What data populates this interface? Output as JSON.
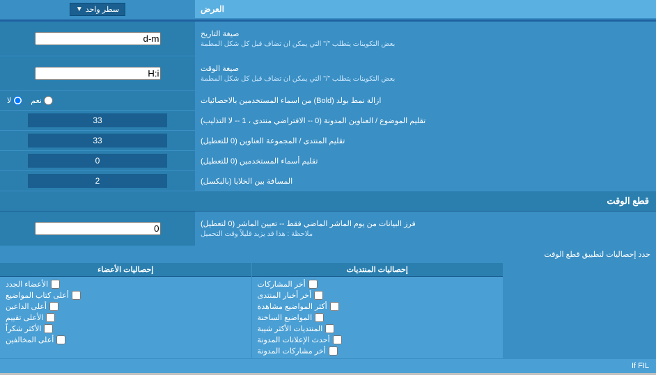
{
  "header": {
    "label_right": "العرض",
    "dropdown_label": "سطر واحد"
  },
  "date_format": {
    "label": "صيغة التاريخ",
    "sublabel": "بعض التكوينات يتطلب \"/\" التي يمكن ان تضاف قبل كل شكل المطمة",
    "value": "d-m"
  },
  "time_format": {
    "label": "صيغة الوقت",
    "sublabel": "بعض التكوينات يتطلب \"/\" التي يمكن ان تضاف قبل كل شكل المطمة",
    "value": "H:i"
  },
  "bold_remove": {
    "label": "ازالة نمط بولد (Bold) من اسماء المستخدمين بالاحصائيات",
    "option_yes": "نعم",
    "option_no": "لا",
    "selected": "no"
  },
  "topic_trim": {
    "label": "تقليم الموضوع / العناوين المدونة (0 -- الافتراضي منتدى ، 1 -- لا التذليب)",
    "value": "33"
  },
  "forum_trim": {
    "label": "تقليم المنتدى / المجموعة العناوين (0 للتعطيل)",
    "value": "33"
  },
  "user_trim": {
    "label": "تقليم أسماء المستخدمين (0 للتعطيل)",
    "value": "0"
  },
  "cell_spacing": {
    "label": "المسافة بين الخلايا (بالبكسل)",
    "value": "2"
  },
  "cutoff_section": {
    "title": "قطع الوقت"
  },
  "cutoff_days": {
    "label": "فرز البيانات من يوم الماشر الماضي فقط -- تعيين الماشر (0 لتعطيل)",
    "note": "ملاحظة : هذا قد يزيد قليلاً وقت التحميل",
    "value": "0"
  },
  "stats_apply": {
    "label": "حدد إحصاليات لتطبيق قطع الوقت"
  },
  "col1_header": "إحصاليات المنتديات",
  "col2_header": "إحصاليات الأعضاء",
  "col1_items": [
    "أخر المشاركات",
    "أخر أخبار المنتدى",
    "أكثر المواضيع مشاهدة",
    "المواضيع الساخنة",
    "المنتديات الأكثر شيبة",
    "أحدث الإعلانات المدونة",
    "أخر مشاركات المدونة"
  ],
  "col2_items": [
    "الأعضاء الجدد",
    "أعلى كتاب المواضيع",
    "أعلى الداعين",
    "الأعلى تقييم",
    "الأكثر شكراً",
    "أعلى المخالفين"
  ],
  "if_fil_text": "If FIL"
}
